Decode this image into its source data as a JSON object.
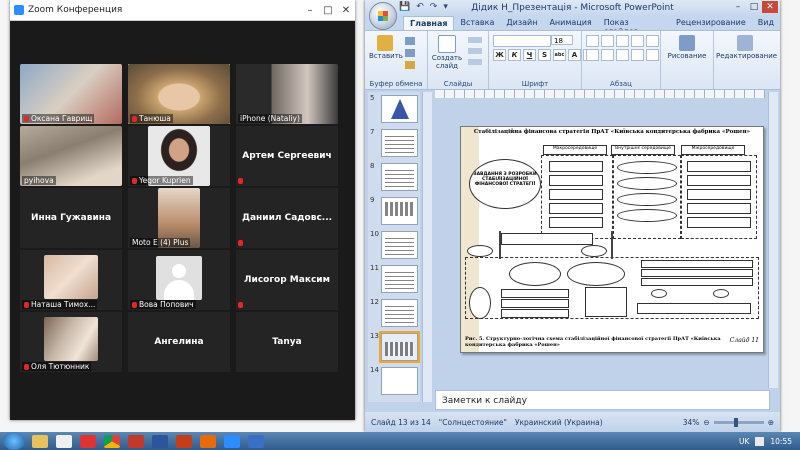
{
  "zoom": {
    "title": "Zoom Конференция",
    "window_controls": [
      "–",
      "□",
      "✕"
    ],
    "participants": [
      {
        "name": "Оксана Гаврищ",
        "video": true,
        "muted": true
      },
      {
        "name": "Танюша",
        "video": true,
        "muted": true,
        "active_speaker": true
      },
      {
        "name": "iPhone (Nataliy)",
        "video": true,
        "muted": false
      },
      {
        "name": "pyihova",
        "video": true,
        "muted": false
      },
      {
        "name": "Yegor Kuprien",
        "video": true,
        "muted": true
      },
      {
        "name": "Артем Сергеевич",
        "video": false,
        "muted": true
      },
      {
        "name": "Инна Гужавина",
        "video": false,
        "muted": false
      },
      {
        "name": "Moto E (4) Plus",
        "video": true,
        "muted": false
      },
      {
        "name": "Даниил  Садовс...",
        "video": false,
        "muted": true
      },
      {
        "name": "Наташа Тимох...",
        "video": true,
        "muted": true
      },
      {
        "name": "Вова Попович",
        "video": false,
        "avatar": true,
        "muted": true
      },
      {
        "name": "Лисогор Максим",
        "video": false,
        "muted": true
      },
      {
        "name": "Оля Тютюнник",
        "video": true,
        "muted": true
      },
      {
        "name": "Ангелина",
        "video": false,
        "muted": false
      },
      {
        "name": "Tanya",
        "video": false,
        "muted": false
      }
    ]
  },
  "powerpoint": {
    "title": "Дідик Н_Презентація - Microsoft PowerPoint",
    "qat": [
      "💾",
      "↶",
      "↷",
      "▾"
    ],
    "window_controls": [
      "–",
      "□",
      "✕"
    ],
    "tabs": [
      "Главная",
      "Вставка",
      "Дизайн",
      "Анимация",
      "Показ слайдов",
      "Рецензирование",
      "Вид"
    ],
    "active_tab": "Главная",
    "groups": {
      "clipboard": {
        "label": "Буфер обмена",
        "paste": "Вставить"
      },
      "slides": {
        "label": "Слайды",
        "new_slide": "Создать слайд"
      },
      "font": {
        "label": "Шрифт",
        "size": "18",
        "buttons": [
          "Ж",
          "К",
          "Ч",
          "S",
          "abc",
          "A",
          "A"
        ]
      },
      "paragraph": {
        "label": "Абзац"
      },
      "drawing": {
        "label": "Рисование"
      },
      "editing": {
        "label": "Редактирование"
      }
    },
    "thumbnails": [
      {
        "num": "5",
        "kind": "pyramid"
      },
      {
        "num": "7",
        "kind": "table"
      },
      {
        "num": "8",
        "kind": "table"
      },
      {
        "num": "9",
        "kind": "dots"
      },
      {
        "num": "10",
        "kind": "table"
      },
      {
        "num": "11",
        "kind": "table"
      },
      {
        "num": "12",
        "kind": "table"
      },
      {
        "num": "13",
        "kind": "diagram",
        "selected": true
      },
      {
        "num": "14",
        "kind": "blank"
      }
    ],
    "slide": {
      "heading": "Стабілізаційна фінансова стратегія ПрАТ «Київська кондитерська фабрика «Рошен»",
      "oval_left": "ЗАВДАННЯ З РОЗРОБКИ СТАБІЛІЗАЦІЙНОЇ ФІНАНСОВОЇ СТРАТЕГІЇ",
      "macro": "Макросередовище",
      "micro": "Мікросередовище",
      "inner": "Внутрішнє середовище",
      "caption": "Рис. 5. Структурно-логічна схема стабілізаційної фінансової стратегії ПрАТ «Київська кондитерська фабрика «Рошен»",
      "slide_label": "Слайд 11"
    },
    "notes_placeholder": "Заметки к слайду",
    "status": {
      "slide": "Слайд 13 из 14",
      "theme": "\"Солнцестояние\"",
      "language": "Украинский (Украина)",
      "zoom": "34%"
    }
  },
  "taskbar": {
    "apps": [
      "explorer",
      "chrome",
      "shield",
      "chrome",
      "pdf",
      "word",
      "powerpoint",
      "ppt-orange",
      "zoom",
      "word2"
    ],
    "language": "UK",
    "clock": "10:55"
  }
}
